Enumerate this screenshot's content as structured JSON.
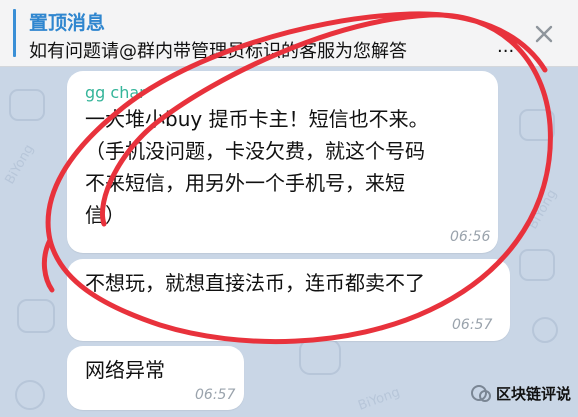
{
  "pinned": {
    "title": "置顶消息",
    "text": "如有问题请@群内带管理员标识的客服为您解答",
    "ellipsis": "..."
  },
  "messages": [
    {
      "sender": "gg char",
      "lines": [
        "一大堆小buy 提币卡主！短信也不来。",
        "（手机没问题，卡没欠费，就这个号码",
        "不来短信，用另外一个手机号，来短",
        "信）"
      ],
      "time": "06:56"
    },
    {
      "lines": [
        "不想玩，就想直接法币，连币都卖不了"
      ],
      "time": "06:57"
    },
    {
      "lines": [
        "网络异常"
      ],
      "time": "06:57"
    }
  ],
  "wallpaper": {
    "text": "BiYong"
  },
  "watermark": {
    "text": "区块链评说",
    "icon": "wechat-channel-icon"
  },
  "colors": {
    "accent": "#3a8fd6",
    "sender": "#35b59a",
    "annotation": "#e8323c",
    "background": "#c9d6e6"
  }
}
